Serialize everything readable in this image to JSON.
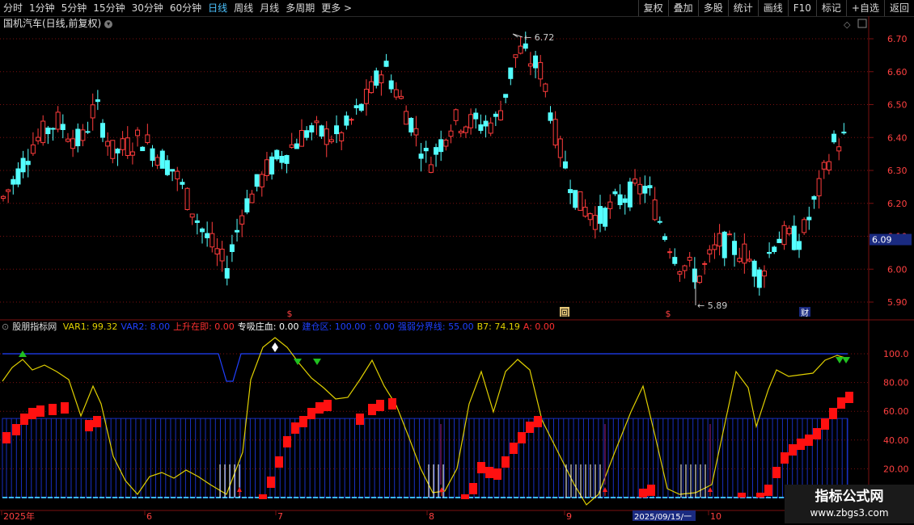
{
  "toolbar": {
    "tabs": [
      "分时",
      "1分钟",
      "5分钟",
      "15分钟",
      "30分钟",
      "60分钟",
      "日线",
      "周线",
      "月线",
      "多周期",
      "更多 >"
    ],
    "active_tab": "日线",
    "right_buttons": [
      "复权",
      "叠加",
      "多股",
      "统计",
      "画线",
      "F10",
      "标记",
      "+自选",
      "返回"
    ]
  },
  "stock_title": "国机汽车(日线,前复权)",
  "price_axis": {
    "ticks": [
      "6.70",
      "6.60",
      "6.50",
      "6.40",
      "6.30",
      "6.20",
      "6.10",
      "6.00",
      "5.90"
    ],
    "current_price": "6.09"
  },
  "annotations": {
    "high": "6.72",
    "low": "5.89"
  },
  "markers": [
    "$",
    "回",
    "$",
    "财"
  ],
  "indicator": {
    "name": "股朋指标网",
    "items": [
      {
        "label": "VAR1: 99.32",
        "color": "#e0d000"
      },
      {
        "label": "VAR2: 8.00",
        "color": "#2040ff"
      },
      {
        "label": "上升在即: 0.00",
        "color": "#ff3030"
      },
      {
        "label": "专吸庄血: 0.00",
        "color": "#ffffff"
      },
      {
        "label": "建仓区: 100.00",
        "color": "#2040ff"
      },
      {
        "label": ": 0.00",
        "color": "#2040ff"
      },
      {
        "label": "强弱分界线: 55.00",
        "color": "#2040ff"
      },
      {
        "label": "B7: 74.19",
        "color": "#e0d000"
      },
      {
        "label": "A: 0.00",
        "color": "#ff3030"
      }
    ],
    "axis_ticks": [
      "100.0",
      "80.00",
      "60.00",
      "40.00",
      "20.00"
    ]
  },
  "date_axis": {
    "labels": [
      "2025年",
      "6",
      "7",
      "8",
      "9",
      "2025/09/15/一",
      "10"
    ]
  },
  "watermark": {
    "line1": "指标公式网",
    "line2": "www.zbgs3.com"
  },
  "colors": {
    "up": "#ff3c3c",
    "down": "#54ffff",
    "grid": "#7a1010",
    "accent": "#4cc3ff"
  }
}
